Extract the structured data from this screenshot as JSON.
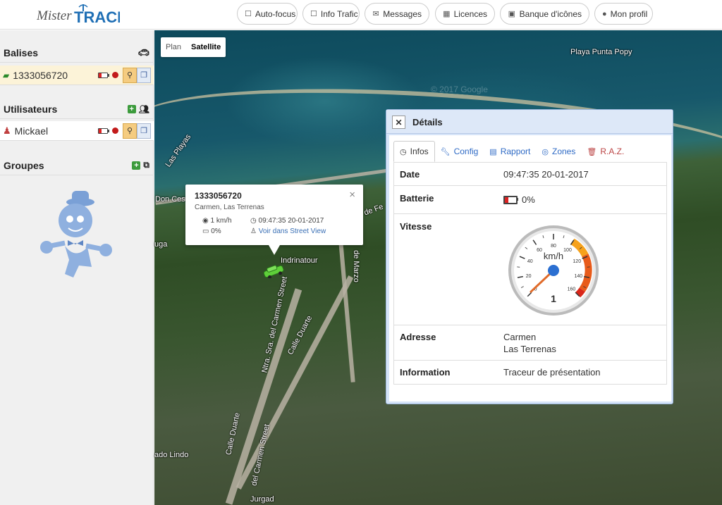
{
  "app": {
    "logo_text": "Mister TRACK"
  },
  "nav": [
    {
      "label": "Auto-focus",
      "icon": "checkbox-icon"
    },
    {
      "label": "Info Trafic",
      "icon": "checkbox-icon"
    },
    {
      "label": "Messages",
      "icon": "envelope-icon"
    },
    {
      "label": "Licences",
      "icon": "calendar-icon"
    },
    {
      "label": "Banque d'icônes",
      "icon": "image-icon"
    },
    {
      "label": "Mon profil",
      "icon": "user-icon"
    }
  ],
  "sidebar": {
    "balises": {
      "title": "Balises",
      "items": [
        {
          "label": "1333056720"
        }
      ]
    },
    "utilisateurs": {
      "title": "Utilisateurs",
      "items": [
        {
          "label": "Mickael"
        }
      ]
    },
    "groupes": {
      "title": "Groupes"
    }
  },
  "map": {
    "types": [
      "Plan",
      "Satellite"
    ],
    "active_type": "Satellite",
    "copyright": "© 2017 Google",
    "labels": {
      "playa": "Playa Punta Popy",
      "las_playas": "Las Playas",
      "don_ces": "Don Ces",
      "uga": "uga",
      "indrinatour": "Indrinatour",
      "ntra_sra": "Ntra. Sra. del Carmen Street",
      "calle_duarte": "Calle Duarte",
      "calle_duarte2": "Calle Duarte",
      "del_carmen": "del Carmen Street",
      "de_marzo": "de Marzo",
      "de_fe": "de Fe",
      "ado_lindo": "ado Lindo",
      "jurgad": "Jurgad"
    }
  },
  "popup": {
    "title": "1333056720",
    "subtitle": "Carmen, Las Terrenas",
    "speed": "1 km/h",
    "datetime": "09:47:35 20-01-2017",
    "battery": "0%",
    "streetview": "Voir dans Street View"
  },
  "details": {
    "title": "Détails",
    "tabs": [
      {
        "label": "Infos",
        "icon": "clock-icon"
      },
      {
        "label": "Config",
        "icon": "wrench-icon"
      },
      {
        "label": "Rapport",
        "icon": "file-icon"
      },
      {
        "label": "Zones",
        "icon": "target-icon"
      },
      {
        "label": "R.A.Z.",
        "icon": "trash-icon"
      }
    ],
    "rows": {
      "date_label": "Date",
      "date_value": "09:47:35 20-01-2017",
      "batterie_label": "Batterie",
      "batterie_value": "0%",
      "vitesse_label": "Vitesse",
      "adresse_label": "Adresse",
      "adresse_line1": "Carmen",
      "adresse_line2": "Las Terrenas",
      "information_label": "Information",
      "information_value": "Traceur de présentation"
    },
    "gauge": {
      "unit": "km/h",
      "value": 1,
      "value_label": "1",
      "min": 0,
      "max": 160,
      "ticks": [
        "0",
        "20",
        "40",
        "60",
        "80",
        "100",
        "120",
        "140",
        "160"
      ]
    }
  }
}
